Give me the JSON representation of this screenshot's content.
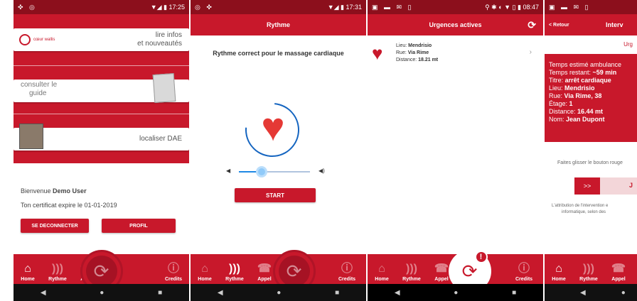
{
  "screen1": {
    "status_left": "✜ ◎",
    "status_right": "▼◢ ▮ 17:25",
    "logo_text": "cœur wallis",
    "card1_text_a": "lire infos",
    "card1_text_b": "et nouveautés",
    "card2_text_a": "consulter le",
    "card2_text_b": "guide",
    "card3_text": "localiser DAE",
    "welcome_prefix": "Bienvenue ",
    "welcome_user": "Demo User",
    "certificate": "Ton certificat expire le 01-01-2019",
    "logout_label": "SE DECONNECTER",
    "profile_label": "PROFIL"
  },
  "screen2": {
    "status_left": "◎ ✜",
    "status_right": "▼◢ ▮ 17:31",
    "title": "Rythme",
    "message": "Rythme correct pour le massage cardiaque",
    "start_label": "START"
  },
  "screen3": {
    "status_left": "▣ ▬ ✉ ▯",
    "status_right": "⚲ ✱ ◐ ▼ ▯ ▮ 08:47",
    "title": "Urgences actives",
    "lieu_label": "Lieu: ",
    "lieu_value": "Mendrisio",
    "rue_label": "Rue: ",
    "rue_value": "Via Rime",
    "distance_label": "Distance: ",
    "distance_value": "18.21 mt"
  },
  "screen4": {
    "status_left": "▣ ▬ ✉ ▯",
    "back_label": "< Retour",
    "title_partial": "Interv",
    "urgency_partial": "Urg",
    "line1": "Temps estimé ambulance",
    "line2_label": "Temps restant: ",
    "line2_value": "~59 min",
    "line3_label": "Titre: ",
    "line3_value": "arrêt cardiaque",
    "line4_label": "Lieu: ",
    "line4_value": "Mendrisio",
    "line5_label": "Rue: ",
    "line5_value": "Via Rime, 38",
    "line6_label": "Étage: ",
    "line6_value": "1",
    "line7_label": "Distance: ",
    "line7_value": "16.44 mt",
    "line8_label": "Nom: ",
    "line8_value": "Jean Dupont",
    "swipe_hint": "Faites glisser le bouton rouge",
    "swipe_btn": ">>",
    "swipe_right": "J",
    "footer_a": "L'attribution de l'intervention e",
    "footer_b": "informatique, selon des"
  },
  "nav": {
    "home": "Home",
    "rythme": "Rythme",
    "appel": "Appel",
    "credits": "Credits"
  },
  "colors": {
    "primary": "#c8182b",
    "status_bar": "#8c0f1c",
    "accent_blue": "#1565c0"
  }
}
